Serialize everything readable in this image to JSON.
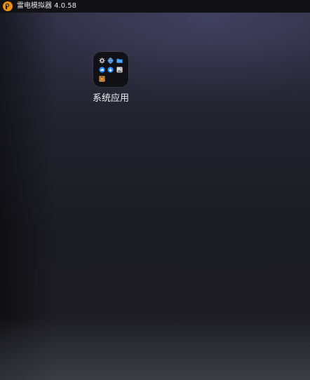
{
  "window": {
    "title": "雷电模拟器 4.0.58",
    "logo_icon": "ldplayer-logo-icon"
  },
  "desktop": {
    "folders": [
      {
        "label": "系统应用",
        "apps": [
          {
            "icon": "settings-icon",
            "color": "#f2f2f2"
          },
          {
            "icon": "browser-globe-icon",
            "color": "#3a8ee6"
          },
          {
            "icon": "file-manager-icon",
            "color": "#2f8fff"
          },
          {
            "icon": "cloud-icon",
            "color": "#2f8fff"
          },
          {
            "icon": "download-icon",
            "color": "#2f8fff"
          },
          {
            "icon": "gallery-icon",
            "color": "#c8c8c8"
          },
          {
            "icon": "store-icon",
            "color": "#e8a24a"
          }
        ]
      }
    ]
  }
}
